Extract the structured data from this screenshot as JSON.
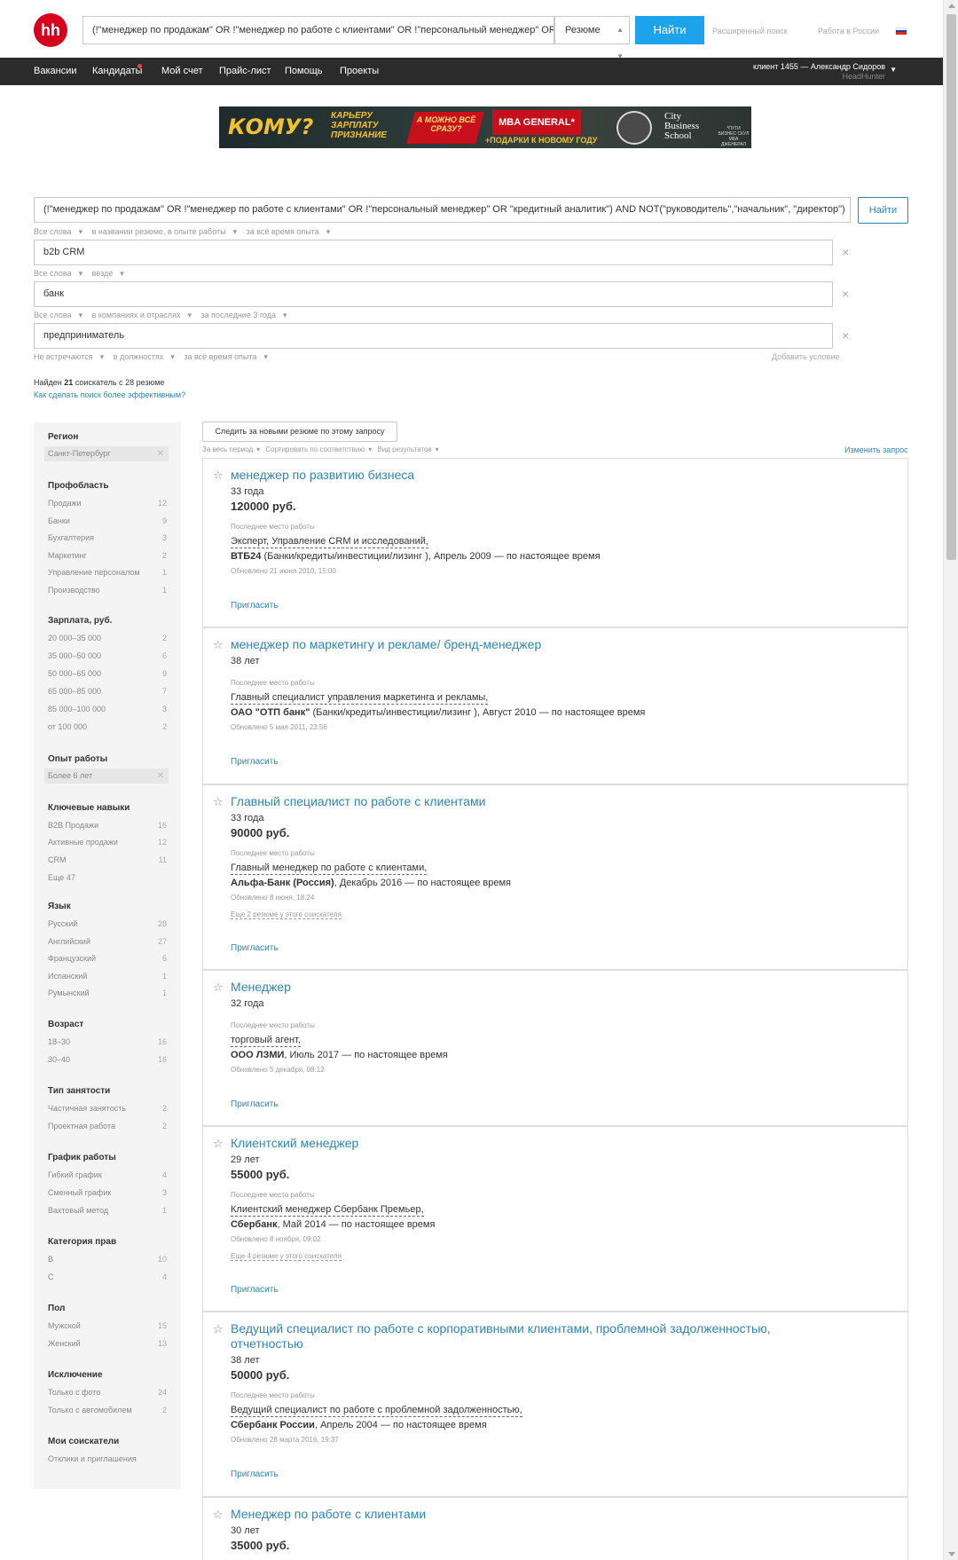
{
  "header": {
    "logo": "hh",
    "search_value": "(!\"менеджер по продажам\" OR !\"менеджер по работе с клиентами\" OR !\"персональный менеджер\" OR",
    "search_type": "Резюме",
    "search_button": "Найти",
    "advanced_search": "Расширенный поиск",
    "region_link": "Работа в России",
    "flag_colors": [
      "#ffffff",
      "#1c3fa5",
      "#d52b1e"
    ]
  },
  "nav": {
    "items": [
      "Вакансии",
      "Кандидаты",
      "Мой счет",
      "Прайс-лист",
      "Помощь",
      "Проекты"
    ],
    "user": "клиент 1455 — Александр Сидоров",
    "company": "HeadHunter"
  },
  "banner": {
    "who": "КОМУ?",
    "career": [
      "КАРЬЕРУ",
      "ЗАРПЛАТУ",
      "ПРИЗНАНИЕ"
    ],
    "all_at_once": "А МОЖНО ВСЁ СРАЗУ?",
    "mba": "MBA GENERAL*",
    "gifts": "+ПОДАРКИ К НОВОМУ ГОДУ",
    "school": [
      "City",
      "Business",
      "School"
    ],
    "small": "*ПУТИ БИЗНЕС СКУЛ МБА ДЖЕНЕРАЛ"
  },
  "query": {
    "main": "(!\"менеджер по продажам\" OR !\"менеджер по работе с клиентами\" OR !\"персональный менеджер\" OR \"кредитный аналитик\") AND NOT(\"руководитель\",\"начальник\", \"директор\")",
    "find_button": "Найти",
    "main_meta": [
      "Все слова",
      "в названии резюме, в опыте работы",
      "за всё время опыта"
    ],
    "row2": "b2b CRM",
    "row2_meta": [
      "Все слова",
      "везде"
    ],
    "row3": "банк",
    "row3_meta": [
      "Все слова",
      "в компаниях и отраслях",
      "за последние 3 года"
    ],
    "row4": "предприниматель",
    "row4_meta": [
      "Не встречаются",
      "в должностях",
      "за всё время опыта"
    ],
    "add_condition": "Добавить условие",
    "found_prefix": "Найден",
    "found_count": "21",
    "found_mid": "соискатель с",
    "found_resumes": "28",
    "found_suffix": "резюме",
    "effective_link": "Как сделать поиск более эффективным?"
  },
  "sidebar": {
    "region": {
      "title": "Регион",
      "chip": "Санкт-Петербург"
    },
    "prof": {
      "title": "Профобласть",
      "items": [
        {
          "label": "Продажи",
          "count": "12"
        },
        {
          "label": "Банки",
          "count": "9"
        },
        {
          "label": "Бухгалтерия",
          "count": "3"
        },
        {
          "label": "Маркетинг",
          "count": "2"
        },
        {
          "label": "Управление персоналом",
          "count": "1"
        },
        {
          "label": "Производство",
          "count": "1"
        }
      ]
    },
    "salary": {
      "title": "Зарплата, руб.",
      "items": [
        {
          "label": "20 000–35 000",
          "count": "2"
        },
        {
          "label": "35 000–50 000",
          "count": "6"
        },
        {
          "label": "50 000–65 000",
          "count": "9"
        },
        {
          "label": "65 000–85 000",
          "count": "7"
        },
        {
          "label": "85 000–100 000",
          "count": "3"
        },
        {
          "label": "от 100 000",
          "count": "2"
        }
      ]
    },
    "experience": {
      "title": "Опыт работы",
      "chip": "Более 6 лет"
    },
    "skills": {
      "title": "Ключевые навыки",
      "items": [
        {
          "label": "B2B Продажи",
          "count": "16"
        },
        {
          "label": "Активные продажи",
          "count": "12"
        },
        {
          "label": "CRM",
          "count": "11"
        },
        {
          "label": "Еще 47",
          "count": ""
        }
      ]
    },
    "lang": {
      "title": "Язык",
      "items": [
        {
          "label": "Русский",
          "count": "28"
        },
        {
          "label": "Английский",
          "count": "27"
        },
        {
          "label": "Французский",
          "count": "6"
        },
        {
          "label": "Испанский",
          "count": "1"
        },
        {
          "label": "Румынский",
          "count": "1"
        }
      ]
    },
    "age": {
      "title": "Возраст",
      "items": [
        {
          "label": "18–30",
          "count": "16"
        },
        {
          "label": "30–40",
          "count": "16"
        }
      ]
    },
    "emp": {
      "title": "Тип занятости",
      "items": [
        {
          "label": "Частичная занятость",
          "count": "2"
        },
        {
          "label": "Проектная работа",
          "count": "2"
        }
      ]
    },
    "sched": {
      "title": "График работы",
      "items": [
        {
          "label": "Гибкий график",
          "count": "4"
        },
        {
          "label": "Сменный график",
          "count": "3"
        },
        {
          "label": "Вахтовый метод",
          "count": "1"
        }
      ]
    },
    "license": {
      "title": "Категория прав",
      "items": [
        {
          "label": "B",
          "count": "10"
        },
        {
          "label": "C",
          "count": "4"
        }
      ]
    },
    "gender": {
      "title": "Пол",
      "items": [
        {
          "label": "Мужской",
          "count": "15"
        },
        {
          "label": "Женский",
          "count": "13"
        }
      ]
    },
    "excl": {
      "title": "Исключение",
      "items": [
        {
          "label": "Только с фото",
          "count": "24"
        },
        {
          "label": "Только с автомобилем",
          "count": "2"
        }
      ]
    },
    "mine": {
      "title": "Мои соискатели",
      "items": [
        {
          "label": "Отклики и приглашения",
          "count": ""
        }
      ]
    }
  },
  "results": {
    "follow_button": "Следить за новыми резюме по этому запросу",
    "meta": [
      "За весь период",
      "Сортировать по соответствию",
      "Вид результатов"
    ],
    "change_query": "Изменить запрос",
    "last_job_label": "Последнее место работы",
    "invite": "Пригласить",
    "cards": [
      {
        "title": "менеджер по развитию бизнеса",
        "age": "33 года",
        "salary": "120000 руб.",
        "position": "Эксперт, Управление CRM и исследований,",
        "company": "ВТБ24",
        "period": " (Банки/кредиты/инвестиции/лизинг ), Апрель 2009 — по настоящее время",
        "updated": "Обновлено 21 июня 2010, 15:00",
        "more": ""
      },
      {
        "title": "менеджер по маркетингу и рекламе/ бренд-менеджер",
        "age": "38 лет",
        "salary": "",
        "position": "Главный специалист управления маркетинга и рекламы,",
        "company": "ОАО \"ОТП банк\"",
        "period": " (Банки/кредиты/инвестиции/лизинг ), Август 2010 — по настоящее время",
        "updated": "Обновлено 5 мая 2011, 23:56",
        "more": ""
      },
      {
        "title": "Главный специалист по работе с клиентами",
        "age": "33 года",
        "salary": "90000 руб.",
        "position": "Главный менеджер по работе с клиентами,",
        "company": "Альфа-Банк (Россия)",
        "period": ", Декабрь 2016 — по настоящее время",
        "updated": "Обновлено 8 июня, 18:24",
        "more": "Еще 2 резюме у этого соискателя"
      },
      {
        "title": "Менеджер",
        "age": "32 года",
        "salary": "",
        "position": "торговый агент,",
        "company": "ООО ЛЗМИ",
        "period": ", Июль 2017 — по настоящее время",
        "updated": "Обновлено 5 декабря, 08:12",
        "more": ""
      },
      {
        "title": "Клиентский менеджер",
        "age": "29 лет",
        "salary": "55000 руб.",
        "position": "Клиентский менеджер Сбербанк Премьер,",
        "company": "Сбербанк",
        "period": ", Май 2014 — по настоящее время",
        "updated": "Обновлено 8 ноября, 09:02",
        "more": "Еще 4 резюме у этого соискателя"
      },
      {
        "title": "Ведущий специалист по работе с корпоративными клиентами, проблемной задолженностью, отчетностью",
        "age": "38 лет",
        "salary": "50000 руб.",
        "position": "Ведущий специалист по работе с проблемной задолженностью,",
        "company": "Сбербанк России",
        "period": ", Апрель 2004 — по настоящее время",
        "updated": "Обновлено 28 марта 2016, 19:37",
        "more": ""
      },
      {
        "title": "Менеджер по работе с клиентами",
        "age": "30 лет",
        "salary": "35000 руб.",
        "position": "",
        "company": "",
        "period": "",
        "updated": "",
        "more": ""
      }
    ]
  }
}
